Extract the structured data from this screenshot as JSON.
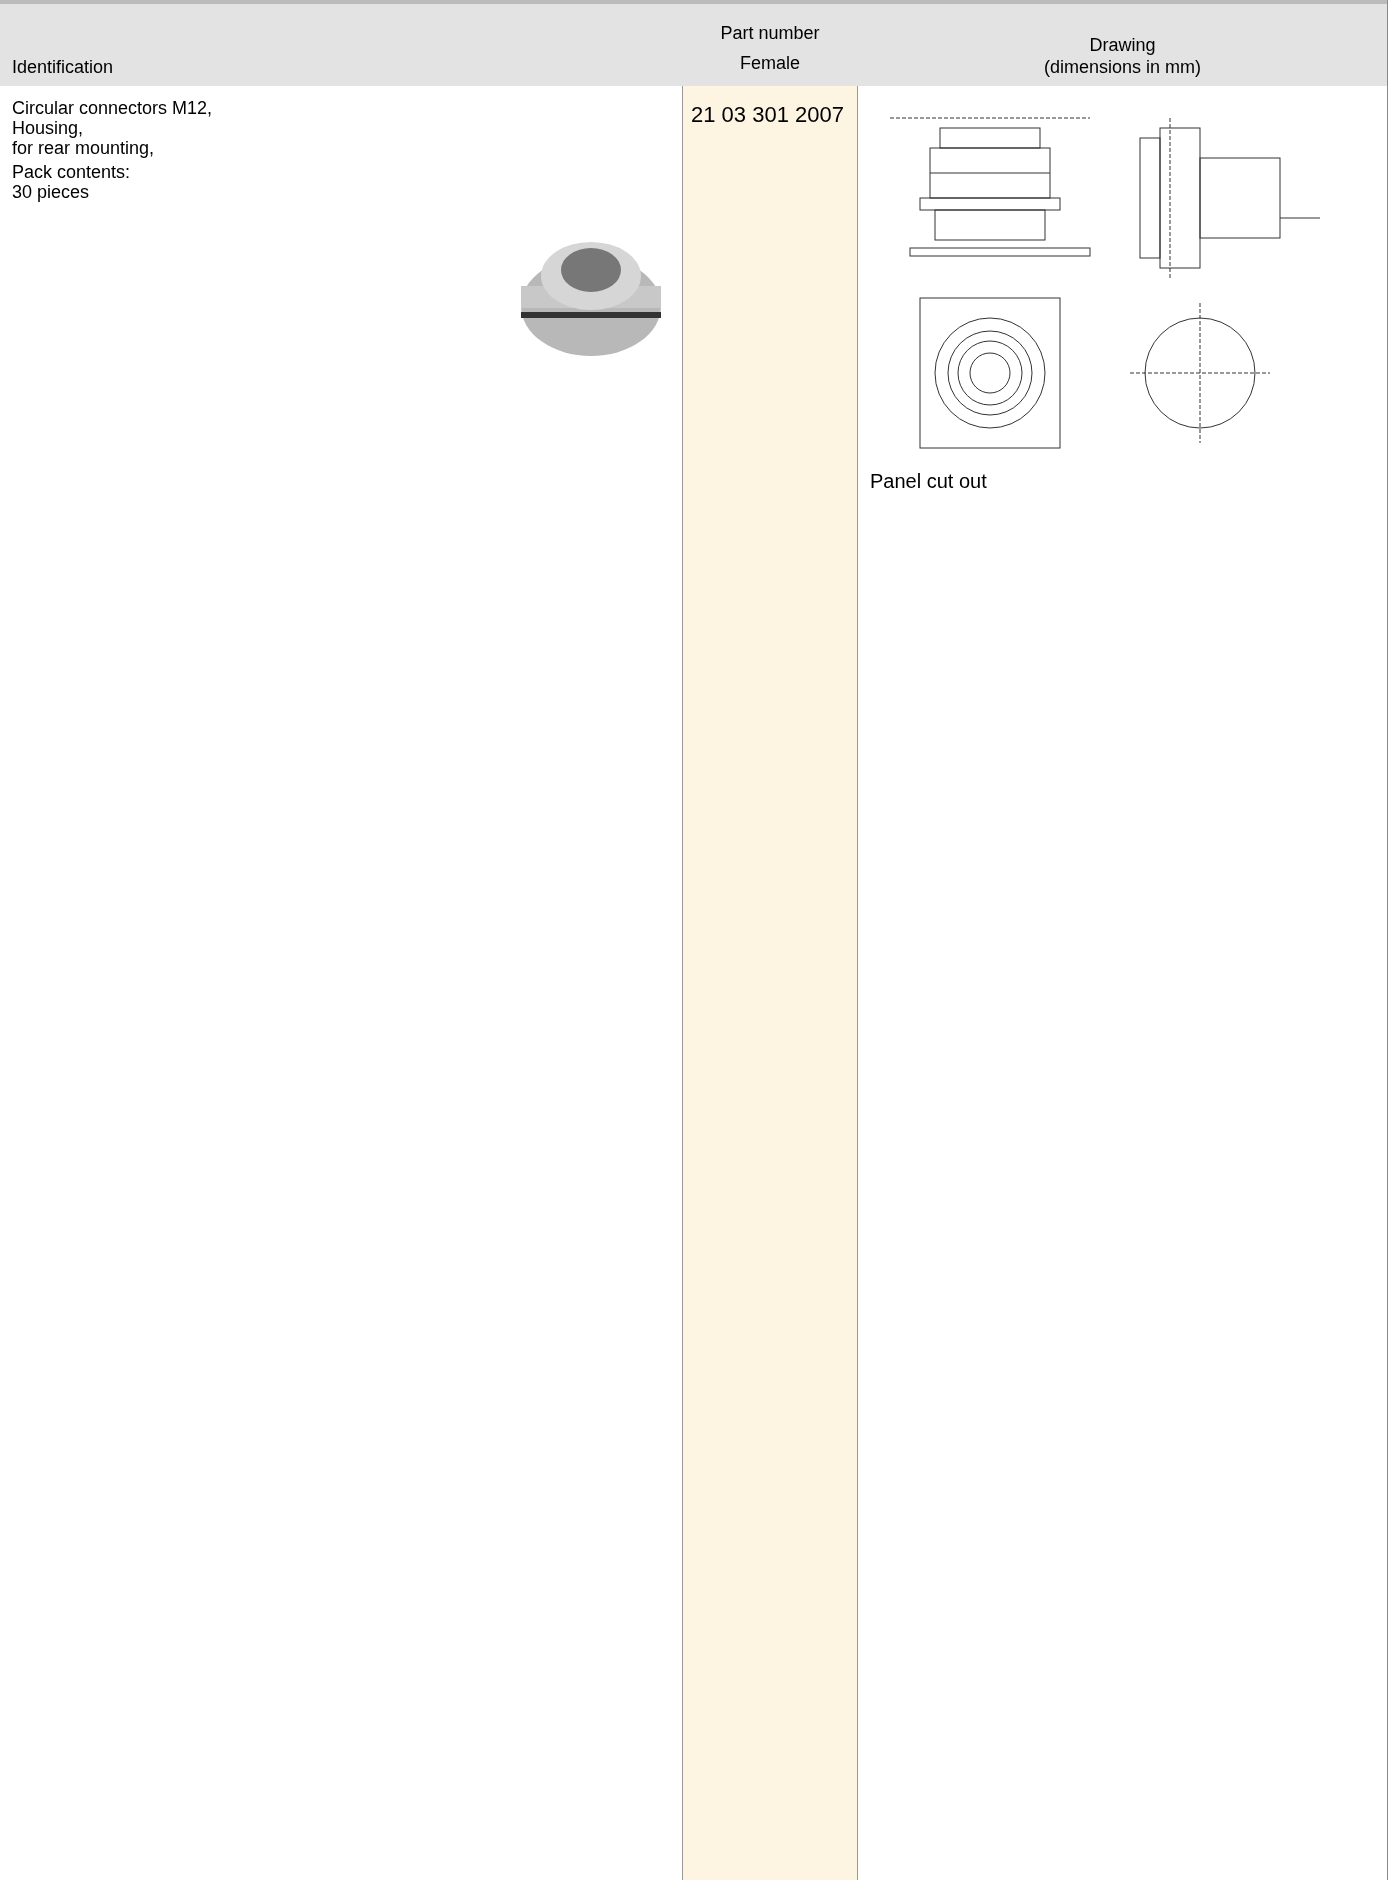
{
  "table": {
    "columns": [
      {
        "lines": [
          "Identification"
        ]
      },
      {
        "lines": [
          "Part number",
          "Female"
        ]
      },
      {
        "lines": [
          "Drawing",
          "(dimensions in mm)"
        ]
      }
    ],
    "rows": [
      {
        "identification": [
          "Circular connectors M12,",
          "Housing,",
          "for rear mounting,"
        ],
        "pack": [
          "Pack contents:",
          "30 pieces"
        ],
        "part_number": "21 03 301 2007",
        "drawing_caption": "Panel cut out"
      }
    ]
  }
}
